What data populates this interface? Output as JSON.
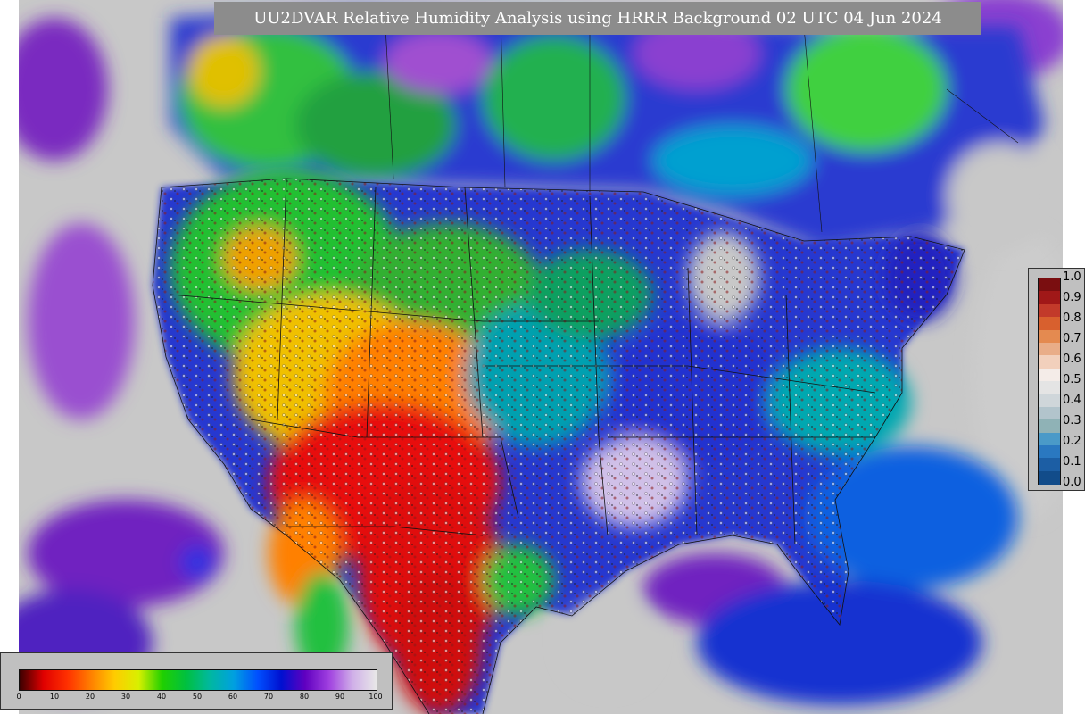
{
  "title": "UU2DVAR Relative Humidity Analysis using HRRR Background 02 UTC 04 Jun 2024",
  "rh_colorbar": {
    "ticks": [
      "1.0",
      "0.9",
      "0.8",
      "0.7",
      "0.6",
      "0.5",
      "0.4",
      "0.3",
      "0.2",
      "0.1",
      "0.0"
    ],
    "colors": [
      "#7a0e10",
      "#a01818",
      "#c23a2a",
      "#d8602e",
      "#e48a50",
      "#e9ad88",
      "#f2d0bc",
      "#f4ece8",
      "#e4e4e4",
      "#cfd6da",
      "#b2c4cc",
      "#8fb2b6",
      "#4a9ac8",
      "#2a78c0",
      "#1c5ea4",
      "#124c8a"
    ]
  },
  "percent_colorbar": {
    "ticks": [
      "0",
      "10",
      "20",
      "30",
      "40",
      "50",
      "60",
      "70",
      "80",
      "90",
      "100"
    ],
    "gradient": [
      "#3a0000",
      "#e00000",
      "#ff3000",
      "#ff8000",
      "#ffcc00",
      "#d8f000",
      "#20d000",
      "#00c040",
      "#00b8a0",
      "#00a0e0",
      "#0050ff",
      "#0010d0",
      "#6000c0",
      "#a040e0",
      "#d0b0e8",
      "#e8e8e8"
    ]
  },
  "map_colors": {
    "ocean": "#c8c8c8",
    "land_moist": "#2233cc",
    "arid": "#e01010",
    "semi_arid": "#ff8000",
    "grassland": "#40c020",
    "humid_canada": "#30d040",
    "very_humid": "#8020c0",
    "cyan_band": "#00b0c0"
  }
}
